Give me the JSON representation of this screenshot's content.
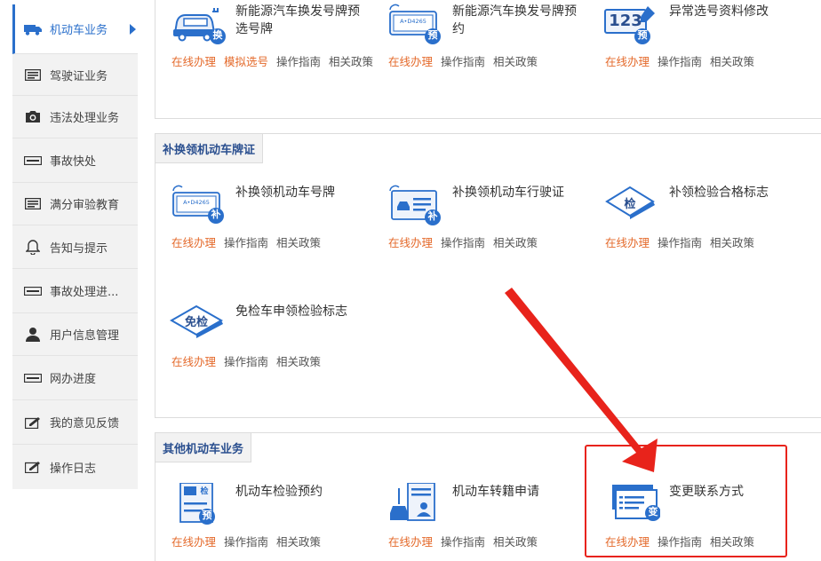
{
  "sidebar": {
    "items": [
      {
        "label": "机动车业务",
        "icon": "car-icon"
      },
      {
        "label": "驾驶证业务",
        "icon": "license-card-icon"
      },
      {
        "label": "违法处理业务",
        "icon": "camera-icon"
      },
      {
        "label": "事故快处",
        "icon": "accident-card-icon"
      },
      {
        "label": "满分审验教育",
        "icon": "education-card-icon"
      },
      {
        "label": "告知与提示",
        "icon": "bell-icon"
      },
      {
        "label": "事故处理进...",
        "icon": "progress-card-icon"
      },
      {
        "label": "用户信息管理",
        "icon": "user-icon"
      },
      {
        "label": "网办进度",
        "icon": "schedule-card-icon"
      },
      {
        "label": "我的意见反馈",
        "icon": "feedback-icon"
      },
      {
        "label": "操作日志",
        "icon": "log-icon"
      }
    ]
  },
  "sections": {
    "top": {
      "items": [
        {
          "name": "新能源汽车换发号牌预选号牌",
          "badge": "换",
          "links": [
            "在线办理",
            "模拟选号",
            "操作指南",
            "相关政策"
          ]
        },
        {
          "name": "新能源汽车换发号牌预约",
          "badge": "预",
          "plate": "A•D4265",
          "links": [
            "在线办理",
            "操作指南",
            "相关政策"
          ]
        },
        {
          "name": "异常选号资料修改",
          "badge": "预",
          "digits": "123",
          "links": [
            "在线办理",
            "操作指南",
            "相关政策"
          ]
        }
      ]
    },
    "replace": {
      "title": "补换领机动车牌证",
      "items": [
        {
          "name": "补换领机动车号牌",
          "badge": "补",
          "plate": "A•D4265",
          "links": [
            "在线办理",
            "操作指南",
            "相关政策"
          ]
        },
        {
          "name": "补换领机动车行驶证",
          "badge": "补",
          "links": [
            "在线办理",
            "操作指南",
            "相关政策"
          ]
        },
        {
          "name": "补领检验合格标志",
          "badge": "检",
          "links": [
            "在线办理",
            "操作指南",
            "相关政策"
          ]
        },
        {
          "name": "免检车申领检验标志",
          "badge": "免检",
          "links": [
            "在线办理",
            "操作指南",
            "相关政策"
          ]
        }
      ]
    },
    "other": {
      "title": "其他机动车业务",
      "items": [
        {
          "name": "机动车检验预约",
          "badge": "预",
          "tag": "检",
          "links": [
            "在线办理",
            "操作指南",
            "相关政策"
          ]
        },
        {
          "name": "机动车转籍申请",
          "links": [
            "在线办理",
            "操作指南",
            "相关政策"
          ]
        },
        {
          "name": "变更联系方式",
          "badge": "变",
          "links": [
            "在线办理",
            "操作指南",
            "相关政策"
          ]
        }
      ]
    }
  },
  "colors": {
    "accent": "#2a6fcb",
    "link_orange": "#e46a2b",
    "annotation_red": "#e8231b"
  }
}
